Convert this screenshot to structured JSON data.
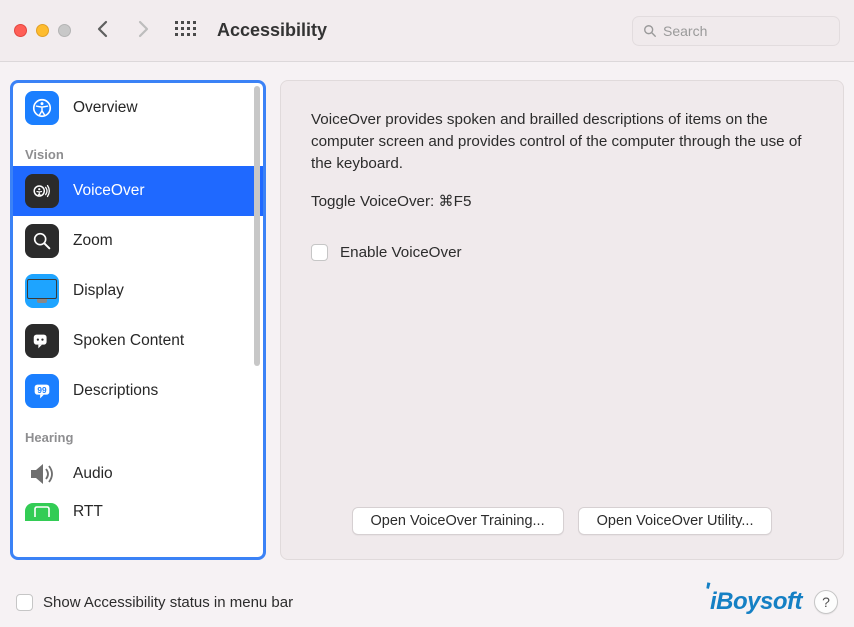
{
  "toolbar": {
    "title": "Accessibility",
    "search_placeholder": "Search"
  },
  "sidebar": {
    "overview": "Overview",
    "section_vision": "Vision",
    "voiceover": "VoiceOver",
    "zoom": "Zoom",
    "display": "Display",
    "spoken_content": "Spoken Content",
    "descriptions": "Descriptions",
    "section_hearing": "Hearing",
    "audio": "Audio",
    "rtt": "RTT"
  },
  "content": {
    "description": "VoiceOver provides spoken and brailled descriptions of items on the computer screen and provides control of the computer through the use of the keyboard.",
    "toggle_line": "Toggle VoiceOver:   ⌘F5",
    "enable_label": "Enable VoiceOver",
    "btn_training": "Open VoiceOver Training...",
    "btn_utility": "Open VoiceOver Utility..."
  },
  "footer": {
    "status_label": "Show Accessibility status in menu bar",
    "logo_text": "iBoysoft",
    "help": "?"
  }
}
